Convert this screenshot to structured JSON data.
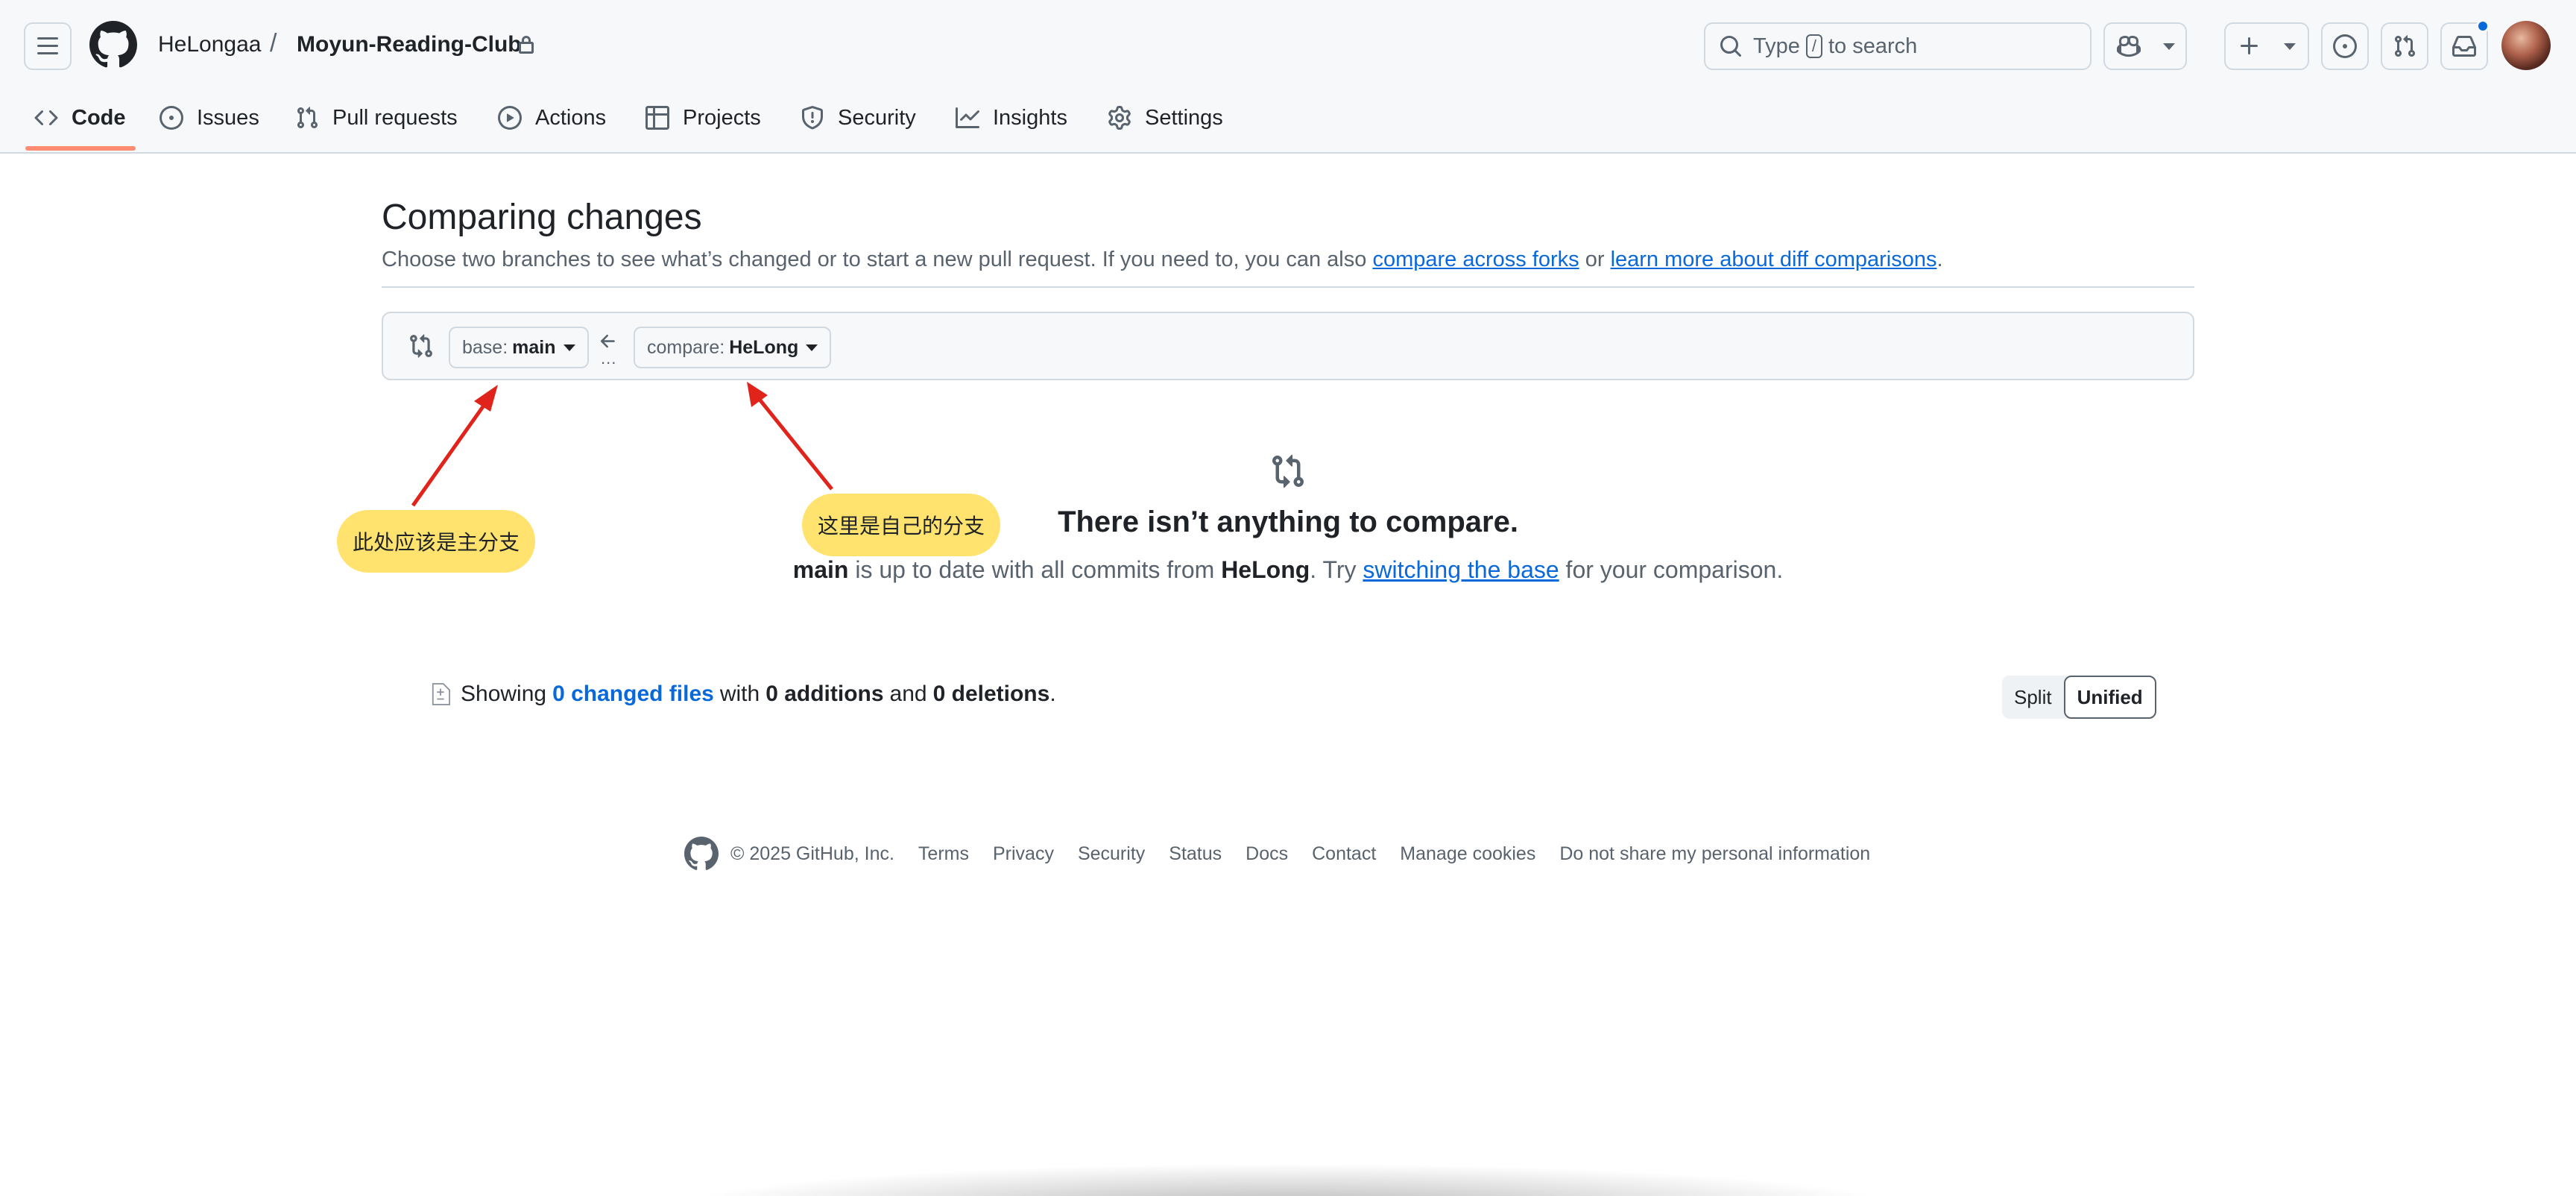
{
  "header": {
    "owner": "HeLongaa",
    "separator": "/",
    "repo": "Moyun-Reading-Club",
    "search_prefix": "Type",
    "search_key": "/",
    "search_suffix": "to search"
  },
  "tabs": [
    {
      "label": "Code",
      "icon": "code-icon",
      "active": true
    },
    {
      "label": "Issues",
      "icon": "issue-opened-icon"
    },
    {
      "label": "Pull requests",
      "icon": "git-pull-request-icon"
    },
    {
      "label": "Actions",
      "icon": "play-icon"
    },
    {
      "label": "Projects",
      "icon": "table-icon"
    },
    {
      "label": "Security",
      "icon": "shield-icon"
    },
    {
      "label": "Insights",
      "icon": "graph-icon"
    },
    {
      "label": "Settings",
      "icon": "gear-icon"
    }
  ],
  "main": {
    "title": "Comparing changes",
    "desc_prefix": "Choose two branches to see what’s changed or to start a new pull request. If you need to, you can also ",
    "desc_link1": "compare across forks",
    "desc_mid": " or ",
    "desc_link2": "learn more about diff comparisons",
    "desc_end": ".",
    "base_label": "base:",
    "base_value": "main",
    "compare_label": "compare:",
    "compare_value": "HeLong",
    "dots": "...",
    "empty_title": "There isn’t anything to compare.",
    "empty_b1": "main",
    "empty_t1": " is up to date with all commits from ",
    "empty_b2": "HeLong",
    "empty_t2": ". Try ",
    "empty_link": "switching the base",
    "empty_t3": " for your comparison.",
    "showing_prefix": "Showing",
    "changed_files": "0 changed files",
    "with": "with",
    "additions": "0 additions",
    "and": "and",
    "deletions": "0 deletions",
    "period": ".",
    "split_label": "Split",
    "unified_label": "Unified"
  },
  "annotations": {
    "callout_base": "此处应该是主分支",
    "callout_compare": "这里是自己的分支",
    "color": "#ffe36e",
    "arrow_color": "#e0241b"
  },
  "footer": {
    "copyright": "© 2025 GitHub, Inc.",
    "links": [
      "Terms",
      "Privacy",
      "Security",
      "Status",
      "Docs",
      "Contact",
      "Manage cookies",
      "Do not share my personal information"
    ]
  },
  "colors": {
    "accent": "#0969da",
    "tab_underline": "#fd8c73",
    "border": "#d1d9e0"
  }
}
